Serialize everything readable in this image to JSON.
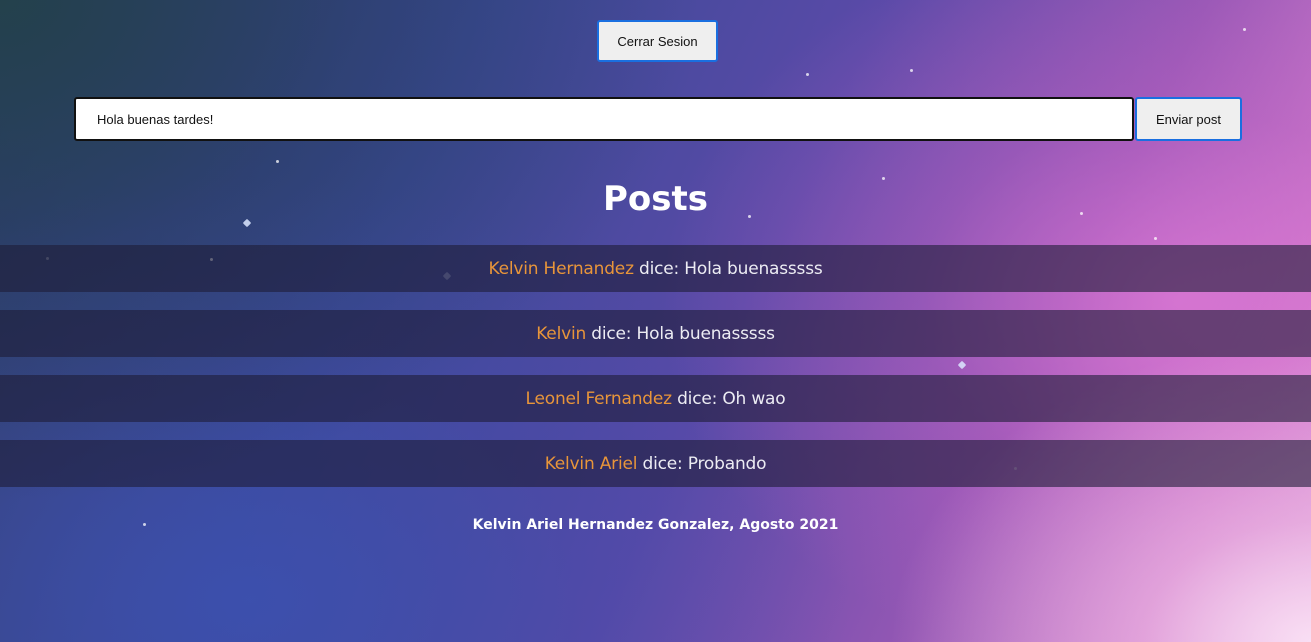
{
  "header": {
    "logout_label": "Cerrar Sesion"
  },
  "composer": {
    "input_value": "Hola buenas tardes!",
    "send_label": "Enviar post"
  },
  "posts_section": {
    "title": "Posts",
    "connector": "dice:",
    "items": [
      {
        "author": "Kelvin Hernandez",
        "message": "Hola buenasssss"
      },
      {
        "author": "Kelvin",
        "message": "Hola buenasssss"
      },
      {
        "author": "Leonel Fernandez",
        "message": "Oh wao"
      },
      {
        "author": "Kelvin Ariel",
        "message": "Probando"
      }
    ]
  },
  "footer": {
    "text": "Kelvin Ariel Hernandez Gonzalez, Agosto 2021"
  },
  "colors": {
    "author": "#e8953a",
    "button_border": "#1a6fe0"
  }
}
